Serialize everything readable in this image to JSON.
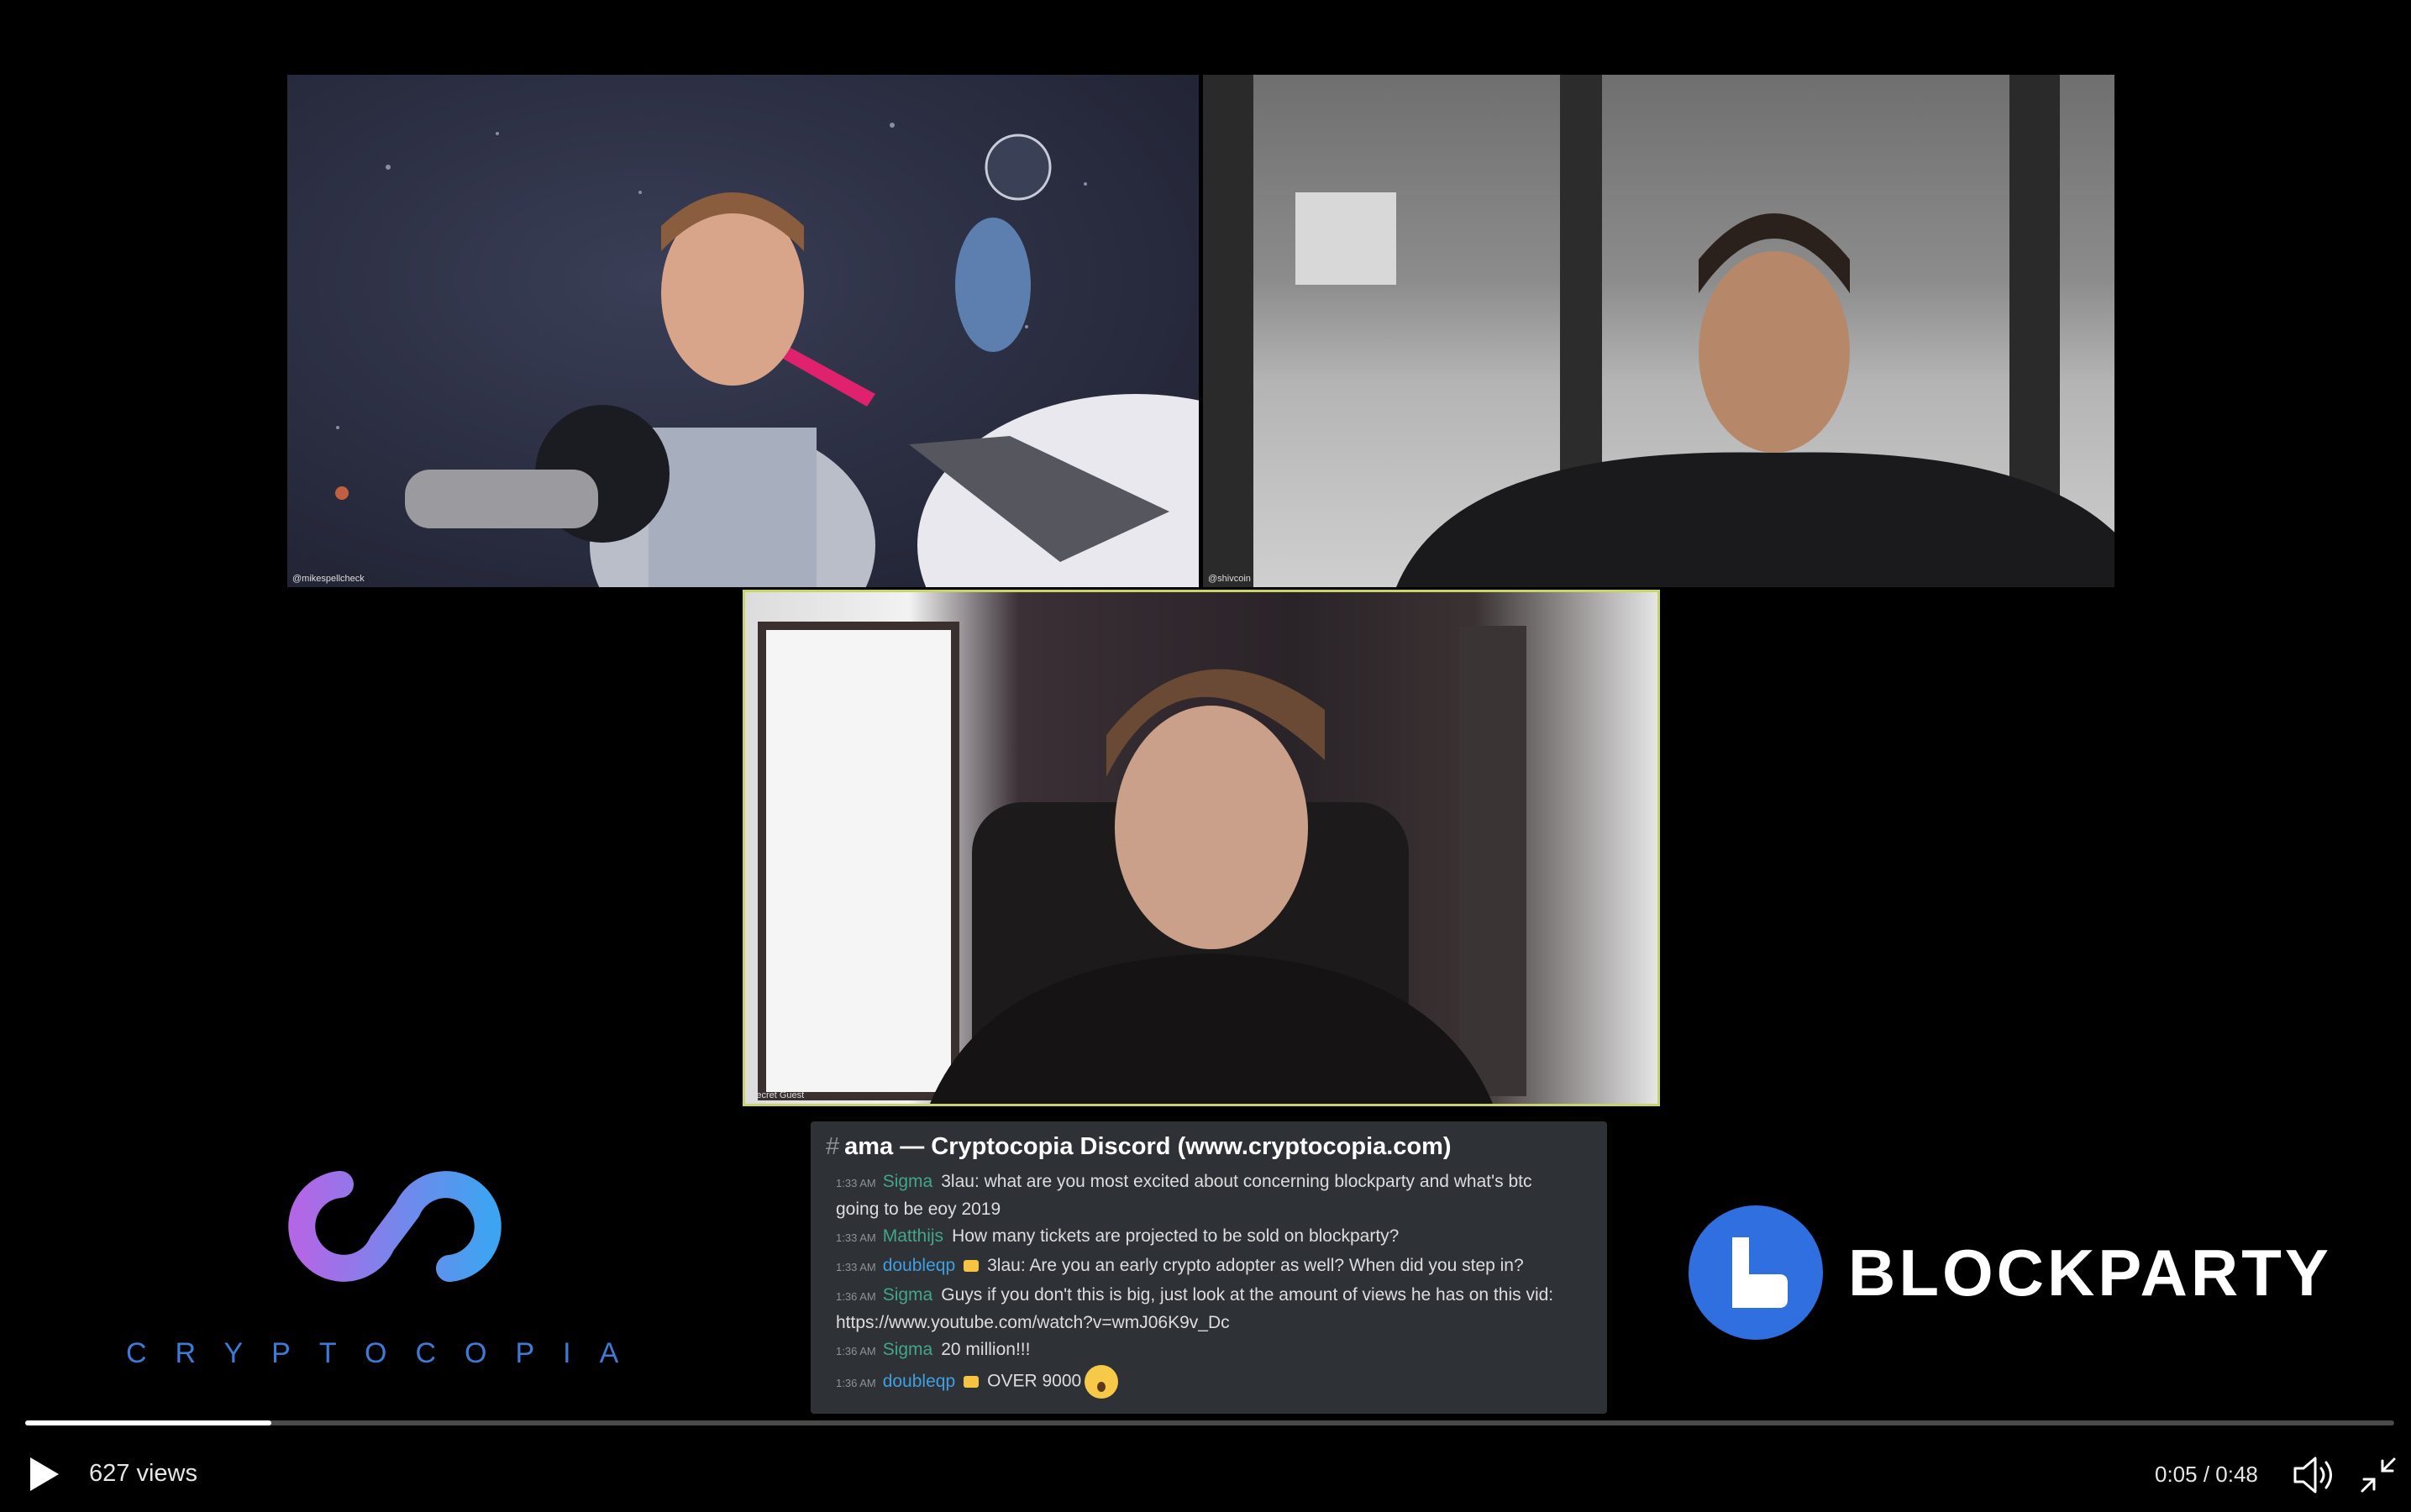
{
  "video": {
    "tiles": [
      {
        "handle": "@mikespellcheck"
      },
      {
        "handle": "@shivcoin"
      },
      {
        "handle": "Secret Guest"
      }
    ]
  },
  "discord": {
    "channel": "ama — Cryptocopia Discord (www.cryptocopia.com)",
    "messages": [
      {
        "time": "1:33 AM",
        "user": "Sigma",
        "text": "3lau: what are you most excited about concerning blockparty and what's btc going to be eoy 2019"
      },
      {
        "time": "1:33 AM",
        "user": "Matthijs",
        "text": "How many tickets are projected to be sold on blockparty?"
      },
      {
        "time": "1:33 AM",
        "user": "doubleqp",
        "text": "3lau: Are you an early crypto adopter as well? When did you step in?"
      },
      {
        "time": "1:36 AM",
        "user": "Sigma",
        "text": "Guys if you don't this is big, just look at the amount of views he has on this vid: https://www.youtube.com/watch?v=wmJ06K9v_Dc"
      },
      {
        "time": "1:36 AM",
        "user": "Sigma",
        "text": "20 million!!!"
      },
      {
        "time": "1:36 AM",
        "user": "doubleqp",
        "text": "OVER 9000"
      }
    ]
  },
  "logos": {
    "left": "CRYPTOCOPIA",
    "right": "BLOCKPARTY"
  },
  "player": {
    "views": "627 views",
    "time": "0:05 / 0:48",
    "progress_fraction": 0.104
  },
  "colors": {
    "background": "#000000",
    "discord_panel": "#2e3136",
    "active_speaker_border": "#c9d36a",
    "username_teal": "#43a68c",
    "username_blue": "#3f9fe0",
    "blockparty_blue": "#2f6fe0"
  },
  "icons": [
    "play-icon",
    "volume-icon",
    "exit-fullscreen-icon"
  ]
}
